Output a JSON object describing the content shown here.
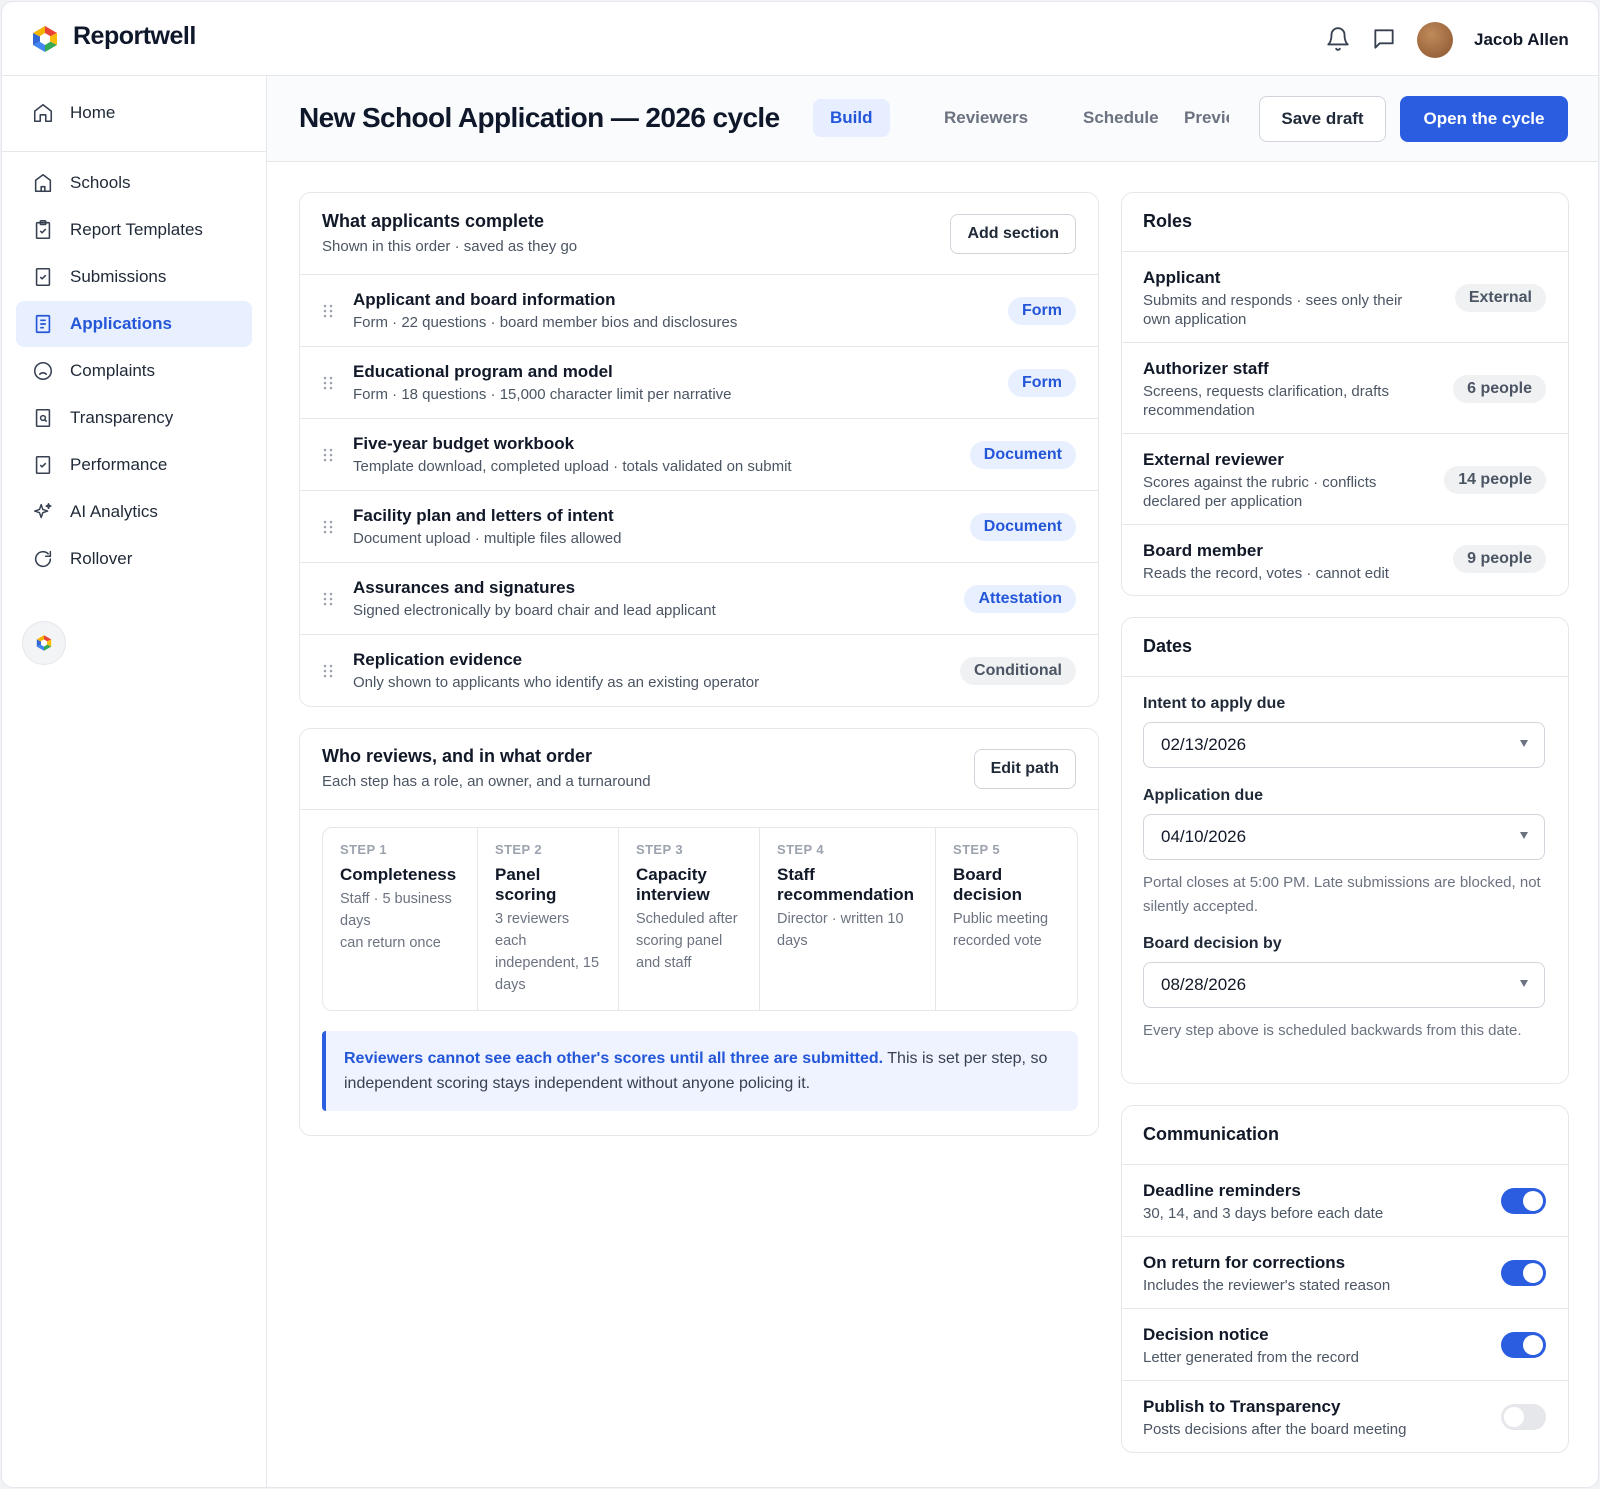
{
  "app": {
    "name": "Reportwell"
  },
  "user": {
    "name": "Jacob Allen"
  },
  "sidebar": {
    "items": [
      {
        "label": "Home",
        "icon": "home-icon"
      },
      {
        "label": "Schools",
        "icon": "building-icon"
      },
      {
        "label": "Report Templates",
        "icon": "clipboard-icon"
      },
      {
        "label": "Submissions",
        "icon": "checkbox-document-icon"
      },
      {
        "label": "Applications",
        "icon": "document-list-icon",
        "active": true
      },
      {
        "label": "Complaints",
        "icon": "sad-face-icon"
      },
      {
        "label": "Transparency",
        "icon": "document-search-icon"
      },
      {
        "label": "Performance",
        "icon": "document-check-icon"
      },
      {
        "label": "AI Analytics",
        "icon": "sparkle-icon"
      },
      {
        "label": "Rollover",
        "icon": "refresh-icon"
      }
    ]
  },
  "header": {
    "title": "New School Application — 2026 cycle",
    "tabs": [
      "Build",
      "Reviewers",
      "Schedule",
      "Preview"
    ],
    "active_tab": "Build",
    "save_label": "Save draft",
    "open_label": "Open the cycle"
  },
  "sections_card": {
    "title": "What applicants complete",
    "subtitle": "Shown in this order · saved as they go",
    "action": "Add section",
    "rows": [
      {
        "title": "Applicant and board information",
        "desc": "Form · 22 questions · board member bios and disclosures",
        "tag": "Form"
      },
      {
        "title": "Educational program and model",
        "desc": "Form · 18 questions · 15,000 character limit per narrative",
        "tag": "Form"
      },
      {
        "title": "Five-year budget workbook",
        "desc": "Template download, completed upload · totals validated on submit",
        "tag": "Document"
      },
      {
        "title": "Facility plan and letters of intent",
        "desc": "Document upload · multiple files allowed",
        "tag": "Document"
      },
      {
        "title": "Assurances and signatures",
        "desc": "Signed electronically by board chair and lead applicant",
        "tag": "Attestation"
      },
      {
        "title": "Replication evidence",
        "desc": "Only shown to applicants who identify as an existing operator",
        "tag": "Conditional"
      }
    ]
  },
  "review_card": {
    "title": "Who reviews, and in what order",
    "subtitle": "Each step has a role, an owner, and a turnaround",
    "action": "Edit path",
    "steps": [
      {
        "no": "STEP 1",
        "title": "Completeness",
        "desc": "Staff · 5 business days",
        "desc2": "can return once"
      },
      {
        "no": "STEP 2",
        "title": "Panel scoring",
        "desc": "3 reviewers each independent, 15 days",
        "desc2": ""
      },
      {
        "no": "STEP 3",
        "title": "Capacity interview",
        "desc": "Scheduled after scoring panel and staff",
        "desc2": ""
      },
      {
        "no": "STEP 4",
        "title": "Staff recommendation",
        "desc": "Director · written 10 days",
        "desc2": ""
      },
      {
        "no": "STEP 5",
        "title": "Board decision",
        "desc": "Public meeting recorded vote",
        "desc2": ""
      }
    ],
    "note_emphasis": "Reviewers cannot see each other's scores until all three are submitted.",
    "note_rest": " This is set per step, so independent scoring stays independent without anyone policing it."
  },
  "roles_card": {
    "title": "Roles",
    "roles": [
      {
        "name": "Applicant",
        "desc": "Submits and responds · sees only their own application",
        "badge": "External"
      },
      {
        "name": "Authorizer staff",
        "desc": "Screens, requests clarification, drafts recommendation",
        "badge": "6 people"
      },
      {
        "name": "External reviewer",
        "desc": "Scores against the rubric · conflicts declared per application",
        "badge": "14 people"
      },
      {
        "name": "Board member",
        "desc": "Reads the record, votes · cannot edit",
        "badge": "9 people"
      }
    ]
  },
  "dates_card": {
    "title": "Dates",
    "intent_label": "Intent to apply due",
    "intent_value": "02/13/2026",
    "app_label": "Application due",
    "app_value": "04/10/2026",
    "app_help": "Portal closes at 5:00 PM. Late submissions are blocked, not silently accepted.",
    "board_label": "Board decision by",
    "board_value": "08/28/2026",
    "board_help": "Every step above is scheduled backwards from this date."
  },
  "comm_card": {
    "title": "Communication",
    "items": [
      {
        "title": "Deadline reminders",
        "desc": "30, 14, and 3 days before each date",
        "on": true
      },
      {
        "title": "On return for corrections",
        "desc": "Includes the reviewer's stated reason",
        "on": true
      },
      {
        "title": "Decision notice",
        "desc": "Letter generated from the record",
        "on": true
      },
      {
        "title": "Publish to Transparency",
        "desc": "Posts decisions after the board meeting",
        "on": false
      }
    ]
  },
  "colors": {
    "accent": "#2a5de0",
    "accent_soft": "#e8efff",
    "border": "#e5e7eb"
  }
}
